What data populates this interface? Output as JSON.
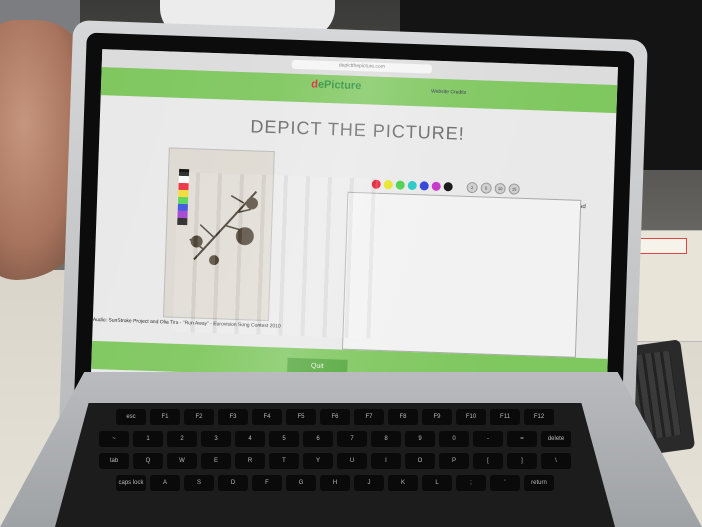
{
  "browser": {
    "address": "depictthepicture.com"
  },
  "site": {
    "logo_first": "d",
    "logo_rest": "ePicture",
    "nav_left": "",
    "nav_right": "Website Credits"
  },
  "page": {
    "title": "DEPICT THE PICTURE!",
    "picture_caption": "",
    "audio_line": "Audio: SunStroke Project and Olia Tira - \"Run Away\" - Eurovision Song Contest 2010"
  },
  "palette": {
    "colors": [
      "#e8192c",
      "#e8e321",
      "#43d046",
      "#1fc7c4",
      "#2a3fd8",
      "#c630c9",
      "#111111"
    ],
    "brush_sizes": [
      "2",
      "5",
      "10",
      "15"
    ]
  },
  "canvas": {
    "download_label": "Download"
  },
  "footer": {
    "quit_label": "Quit"
  },
  "picture_colors": [
    "#111111",
    "#ffffff",
    "#e8192c",
    "#f2d61a",
    "#43d046",
    "#2a3fd8",
    "#9b2cc9",
    "#111111"
  ],
  "keyboard": {
    "row1": [
      "esc",
      "F1",
      "F2",
      "F3",
      "F4",
      "F5",
      "F6",
      "F7",
      "F8",
      "F9",
      "F10",
      "F11",
      "F12"
    ],
    "row2": [
      "~",
      "1",
      "2",
      "3",
      "4",
      "5",
      "6",
      "7",
      "8",
      "9",
      "0",
      "-",
      "=",
      "delete"
    ],
    "row3": [
      "tab",
      "Q",
      "W",
      "E",
      "R",
      "T",
      "Y",
      "U",
      "I",
      "O",
      "P",
      "[",
      "]",
      "\\"
    ],
    "row4": [
      "caps lock",
      "A",
      "S",
      "D",
      "F",
      "G",
      "H",
      "J",
      "K",
      "L",
      ";",
      "'",
      "return"
    ]
  }
}
